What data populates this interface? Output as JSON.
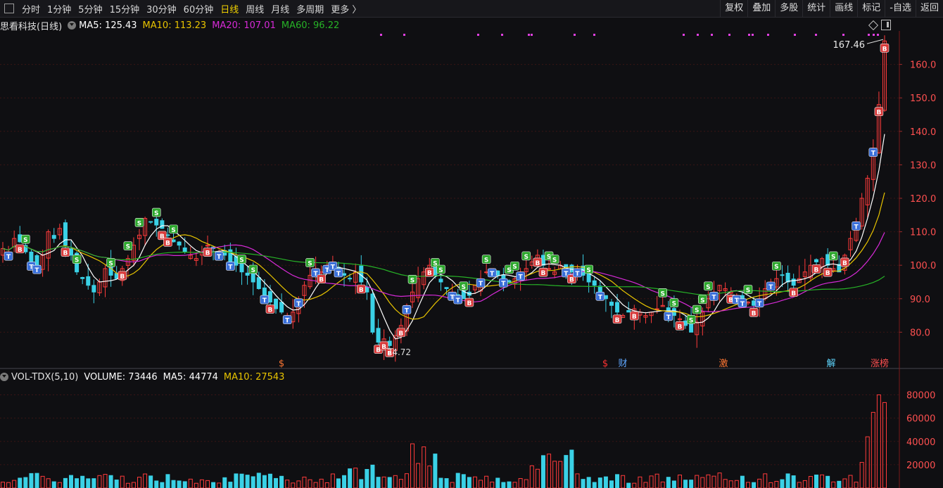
{
  "toolbar": {
    "tabs": [
      "分时",
      "1分钟",
      "5分钟",
      "15分钟",
      "30分钟",
      "60分钟",
      "日线",
      "周线",
      "月线",
      "多周期",
      "更多 〉"
    ],
    "active_tab": "日线",
    "right_buttons": [
      "复权",
      "叠加",
      "多股",
      "统计",
      "画线",
      "标记",
      "-自选",
      "返回"
    ]
  },
  "main": {
    "stock_title": "思看科技(日线)",
    "ma5": "MA5: 125.43",
    "ma10": "MA10: 113.23",
    "ma20": "MA20: 107.01",
    "ma60": "MA60: 96.22",
    "high_marker": "167.46",
    "low_marker": "74.72",
    "event_tags": [
      "$",
      "$",
      "财",
      "激",
      "解",
      "涨榜"
    ]
  },
  "volume": {
    "indicator": "VOL-TDX(5,10)",
    "volume": "VOLUME: 73446",
    "ma5": "MA5: 44774",
    "ma10": "MA10: 27543"
  },
  "colors": {
    "up": "#ff3b3b",
    "down": "#3ad1e6",
    "ma5": "#ffffff",
    "ma10": "#e8c400",
    "ma20": "#d72ad7",
    "ma60": "#27b327",
    "active_tab": "#f0d000",
    "background": "#0f0f12"
  },
  "chart_data": {
    "type": "candlestick",
    "price_axis": {
      "ticks": [
        "160.0",
        "150.0",
        "140.0",
        "130.0",
        "120.0",
        "110.0",
        "100.0",
        "90.0",
        "80.0"
      ],
      "min": 70,
      "max": 170
    },
    "volume_axis": {
      "ticks": [
        "80000",
        "60000",
        "40000",
        "20000"
      ],
      "min": 0,
      "max": 90000
    },
    "close_path": [
      105,
      104,
      108,
      107,
      104,
      101,
      100,
      103,
      110,
      108,
      111,
      106,
      103,
      98,
      96,
      94,
      92,
      95,
      99,
      97,
      96,
      99,
      102,
      106,
      109,
      114,
      113,
      112,
      111,
      109,
      107,
      106,
      104,
      103,
      102,
      104,
      106,
      105,
      104,
      103,
      101,
      100,
      98,
      97,
      95,
      93,
      91,
      89,
      87,
      86,
      85,
      86,
      90,
      94,
      97,
      99,
      98,
      100,
      101,
      99,
      97,
      96,
      98,
      95,
      92,
      80,
      77,
      78,
      76,
      79,
      82,
      88,
      92,
      96,
      98,
      100,
      97,
      95,
      93,
      92,
      91,
      90,
      91,
      94,
      96,
      98,
      99,
      97,
      96,
      95,
      96,
      98,
      99,
      101,
      103,
      100,
      99,
      98,
      100,
      99,
      98,
      99,
      97,
      95,
      94,
      92,
      90,
      88,
      86,
      85,
      86,
      87,
      86,
      85,
      86,
      87,
      88,
      86,
      85,
      84,
      82,
      80,
      83,
      86,
      90,
      92,
      94,
      93,
      92,
      91,
      90,
      89,
      88,
      90,
      93,
      95,
      96,
      97,
      95,
      94,
      96,
      98,
      100,
      101,
      102,
      100,
      99,
      98,
      103,
      108,
      113,
      120,
      126,
      135,
      148,
      167
    ]
  }
}
